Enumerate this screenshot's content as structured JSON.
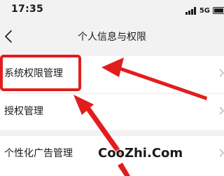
{
  "status_bar": {
    "time": "17:35",
    "network": "5G",
    "signal_icon": "cellular-signal-icon",
    "battery_icon": "battery-icon"
  },
  "nav": {
    "back_icon": "chevron-left-icon",
    "title": "个人信息与权限"
  },
  "settings": {
    "items": [
      {
        "label": "系统权限管理",
        "chevron_icon": "chevron-right-icon",
        "highlighted": true
      },
      {
        "label": "授权管理",
        "chevron_icon": "chevron-right-icon",
        "highlighted": false
      },
      {
        "label": "个性化广告管理",
        "chevron_icon": "chevron-right-icon",
        "highlighted": false
      }
    ]
  },
  "annotation": {
    "color": "#e21d1d",
    "arrow_count": 3
  },
  "watermark": {
    "text": "CooZhi.Com"
  }
}
